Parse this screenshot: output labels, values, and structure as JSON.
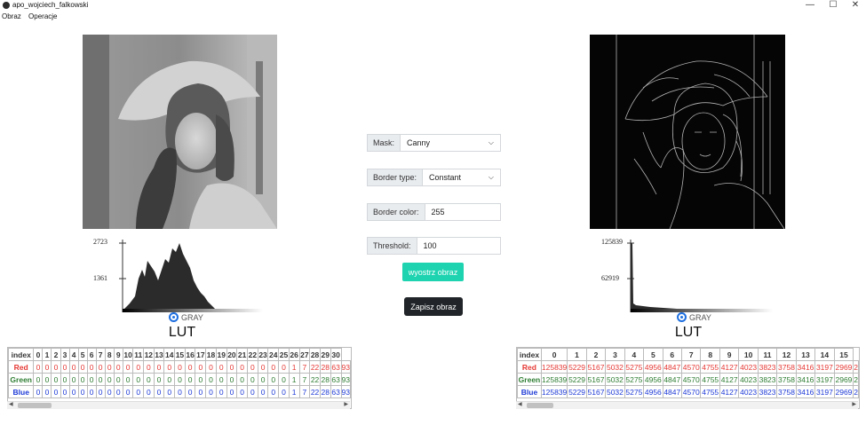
{
  "window": {
    "title": "apo_wojciech_falkowski",
    "minimize": "—",
    "maximize": "☐",
    "close": "✕"
  },
  "menu": [
    "Obraz",
    "Operacje"
  ],
  "left": {
    "hist_max": "2723",
    "hist_mid": "1361",
    "radio_label": "GRAY",
    "lut_title": "LUT",
    "table": {
      "headers": [
        "index",
        "0",
        "1",
        "2",
        "3",
        "4",
        "5",
        "6",
        "7",
        "8",
        "9",
        "10",
        "11",
        "12",
        "13",
        "14",
        "15",
        "16",
        "17",
        "18",
        "19",
        "20",
        "21",
        "22",
        "23",
        "24",
        "25",
        "26",
        "27",
        "28",
        "29",
        "30"
      ],
      "rows": [
        {
          "label": "Red",
          "color": "red",
          "values": [
            "0",
            "0",
            "0",
            "0",
            "0",
            "0",
            "0",
            "0",
            "0",
            "0",
            "0",
            "0",
            "0",
            "0",
            "0",
            "0",
            "0",
            "0",
            "0",
            "0",
            "0",
            "0",
            "0",
            "0",
            "0",
            "0",
            "1",
            "7",
            "22",
            "28",
            "63",
            "93"
          ]
        },
        {
          "label": "Green",
          "color": "green",
          "values": [
            "0",
            "0",
            "0",
            "0",
            "0",
            "0",
            "0",
            "0",
            "0",
            "0",
            "0",
            "0",
            "0",
            "0",
            "0",
            "0",
            "0",
            "0",
            "0",
            "0",
            "0",
            "0",
            "0",
            "0",
            "0",
            "0",
            "1",
            "7",
            "22",
            "28",
            "63",
            "93"
          ]
        },
        {
          "label": "Blue",
          "color": "blue",
          "values": [
            "0",
            "0",
            "0",
            "0",
            "0",
            "0",
            "0",
            "0",
            "0",
            "0",
            "0",
            "0",
            "0",
            "0",
            "0",
            "0",
            "0",
            "0",
            "0",
            "0",
            "0",
            "0",
            "0",
            "0",
            "0",
            "0",
            "1",
            "7",
            "22",
            "28",
            "63",
            "93"
          ]
        }
      ]
    }
  },
  "right": {
    "hist_max": "125839",
    "hist_mid": "62919",
    "radio_label": "GRAY",
    "lut_title": "LUT",
    "table": {
      "headers": [
        "index",
        "0",
        "1",
        "2",
        "3",
        "4",
        "5",
        "6",
        "7",
        "8",
        "9",
        "10",
        "11",
        "12",
        "13",
        "14",
        "15"
      ],
      "rows": [
        {
          "label": "Red",
          "color": "red",
          "values": [
            "125839",
            "5229",
            "5167",
            "5032",
            "5275",
            "4956",
            "4847",
            "4570",
            "4755",
            "4127",
            "4023",
            "3823",
            "3758",
            "3416",
            "3197",
            "2969",
            "2"
          ]
        },
        {
          "label": "Green",
          "color": "green",
          "values": [
            "125839",
            "5229",
            "5167",
            "5032",
            "5275",
            "4956",
            "4847",
            "4570",
            "4755",
            "4127",
            "4023",
            "3823",
            "3758",
            "3416",
            "3197",
            "2969",
            "2"
          ]
        },
        {
          "label": "Blue",
          "color": "blue",
          "values": [
            "125839",
            "5229",
            "5167",
            "5032",
            "5275",
            "4956",
            "4847",
            "4570",
            "4755",
            "4127",
            "4023",
            "3823",
            "3758",
            "3416",
            "3197",
            "2969",
            "2"
          ]
        }
      ]
    }
  },
  "controls": {
    "mask": {
      "label": "Mask:",
      "value": "Canny"
    },
    "border_type": {
      "label": "Border type:",
      "value": "Constant"
    },
    "border_color": {
      "label": "Border color:",
      "value": "255"
    },
    "threshold": {
      "label": "Threshold:",
      "value": "100"
    },
    "sharpen_button": "wyostrz obraz",
    "save_button": "Zapisz obraz"
  },
  "colors": {
    "accent": "#1dd3b0",
    "dark_button": "#212529",
    "red": "#e53935",
    "green": "#2e7d32",
    "blue": "#1e3ad6",
    "radio": "#1e6fe0"
  }
}
